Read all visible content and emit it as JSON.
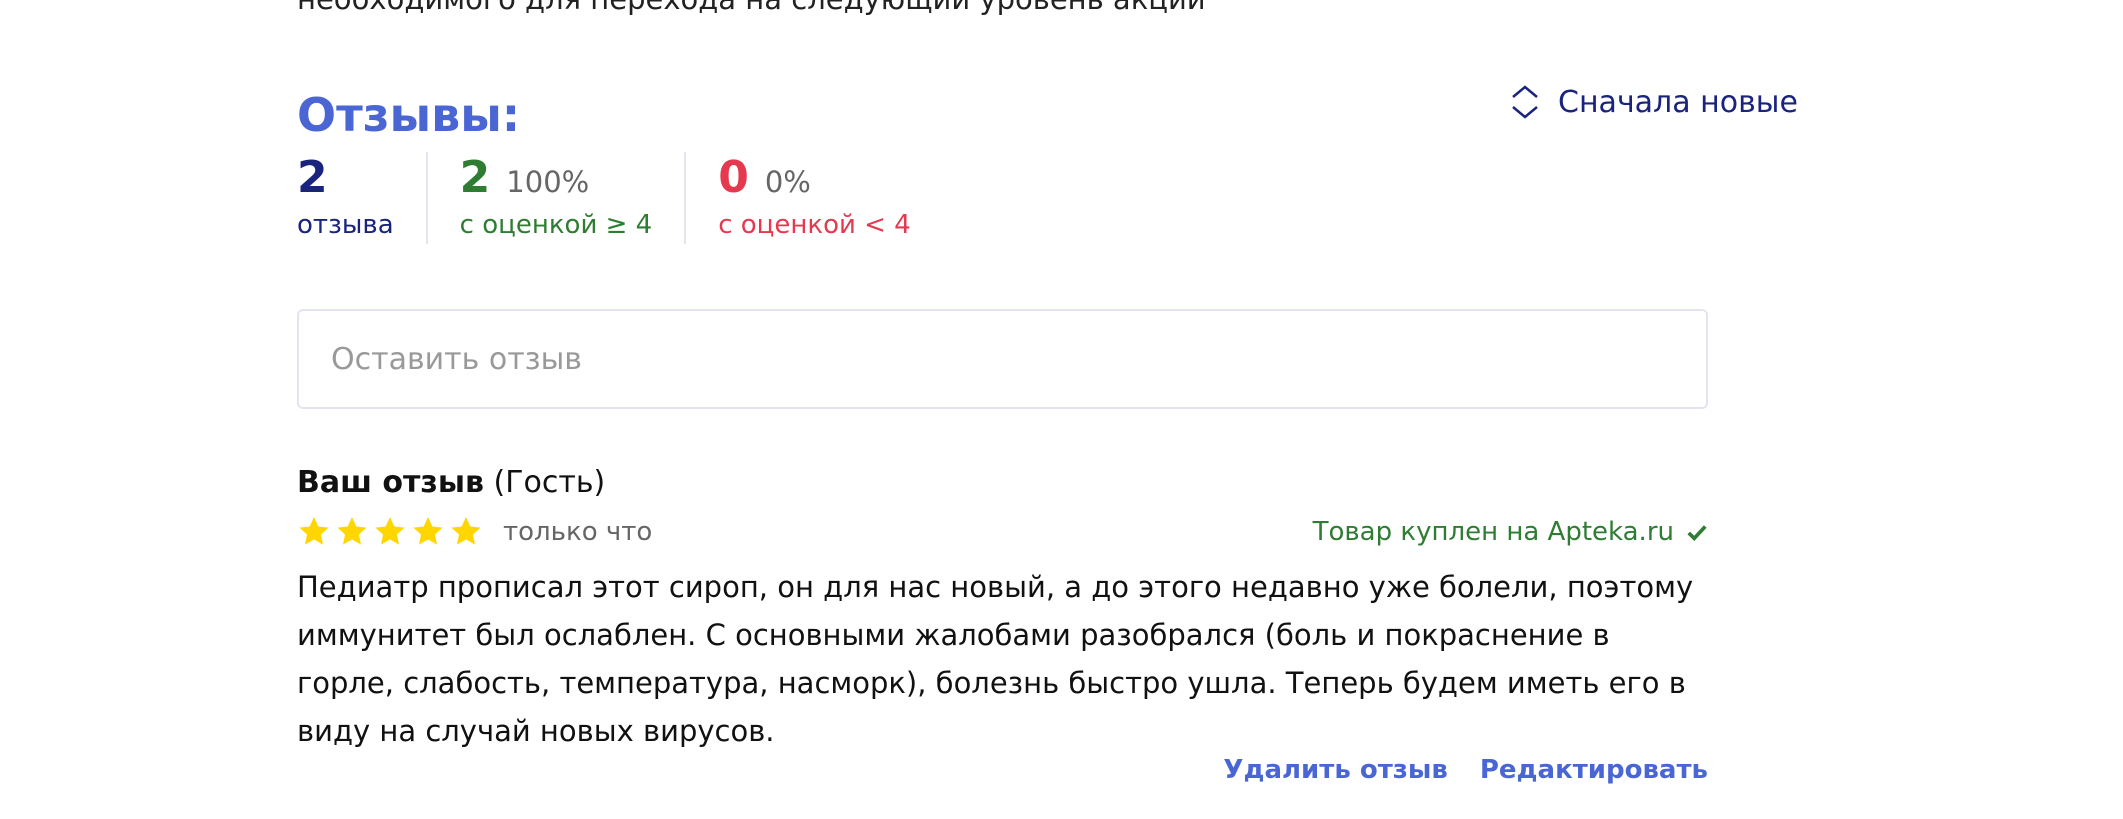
{
  "top_text": "необходимого для перехода на следующий уровень акции",
  "reviews": {
    "title": "Отзывы:",
    "sort_label": "Сначала новые",
    "stats": {
      "total": {
        "count": "2",
        "label": "отзыва"
      },
      "good": {
        "count": "2",
        "percent": "100%",
        "label": "с оценкой ≥ 4"
      },
      "bad": {
        "count": "0",
        "percent": "0%",
        "label": "с оценкой < 4"
      }
    },
    "input_placeholder": "Оставить отзыв",
    "item": {
      "title": "Ваш отзыв",
      "author": "(Гость)",
      "rating": 5,
      "time": "только что",
      "purchased": "Товар куплен на Apteka.ru",
      "text": "Педиатр прописал этот сироп, он для нас новый, а до этого недавно уже болели, поэтому иммунитет был ослаблен. С основными жалобами разобрался (боль и покраснение в горле, слабость, температура, насморк), болезнь быстро ушла. Теперь будем иметь его в виду на случай новых вирусов.",
      "delete_label": "Удалить отзыв",
      "edit_label": "Редактировать"
    }
  },
  "colors": {
    "accent": "#4a66d4",
    "dark_blue": "#1a237e",
    "green": "#2e7d32",
    "red": "#e53950",
    "star": "#ffd600"
  },
  "icons": {
    "sort": "sort-arrows-icon",
    "star": "star-icon",
    "check": "check-icon"
  }
}
